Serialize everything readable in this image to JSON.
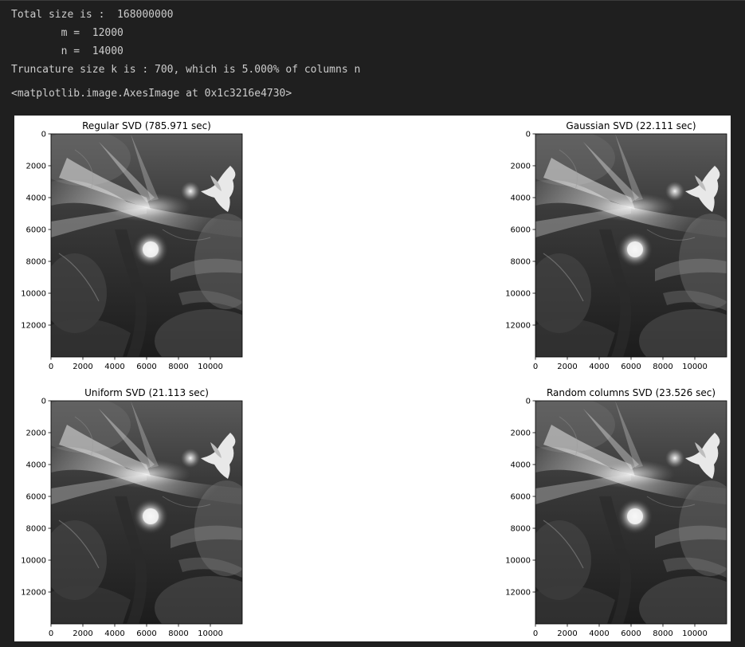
{
  "output": {
    "line1": "Total size is :  168000000",
    "line2": "        m =  12000",
    "line3": "        n =  14000",
    "line4": "Truncature size k is : 700, which is 5.000% of columns n",
    "repr": "<matplotlib.image.AxesImage at 0x1c3216e4730>"
  },
  "colors": {
    "background": "#1f1f1f",
    "text": "#cccccc",
    "figure": "#ffffff"
  },
  "chart_data": [
    {
      "type": "image",
      "title": "Regular SVD (785.971 sec)",
      "xticks": [
        0,
        2000,
        4000,
        6000,
        8000,
        10000
      ],
      "yticks": [
        0,
        2000,
        4000,
        6000,
        8000,
        10000,
        12000
      ],
      "xlim": [
        0,
        12000
      ],
      "ylim": [
        14000,
        0
      ]
    },
    {
      "type": "image",
      "title": "Gaussian SVD (22.111 sec)",
      "xticks": [
        0,
        2000,
        4000,
        6000,
        8000,
        10000
      ],
      "yticks": [
        0,
        2000,
        4000,
        6000,
        8000,
        10000,
        12000
      ],
      "xlim": [
        0,
        12000
      ],
      "ylim": [
        14000,
        0
      ]
    },
    {
      "type": "image",
      "title": "Uniform SVD (21.113 sec)",
      "xticks": [
        0,
        2000,
        4000,
        6000,
        8000,
        10000
      ],
      "yticks": [
        0,
        2000,
        4000,
        6000,
        8000,
        10000,
        12000
      ],
      "xlim": [
        0,
        12000
      ],
      "ylim": [
        14000,
        0
      ]
    },
    {
      "type": "image",
      "title": "Random columns SVD (23.526 sec)",
      "xticks": [
        0,
        2000,
        4000,
        6000,
        8000,
        10000
      ],
      "yticks": [
        0,
        2000,
        4000,
        6000,
        8000,
        10000,
        12000
      ],
      "xlim": [
        0,
        12000
      ],
      "ylim": [
        14000,
        0
      ]
    }
  ]
}
